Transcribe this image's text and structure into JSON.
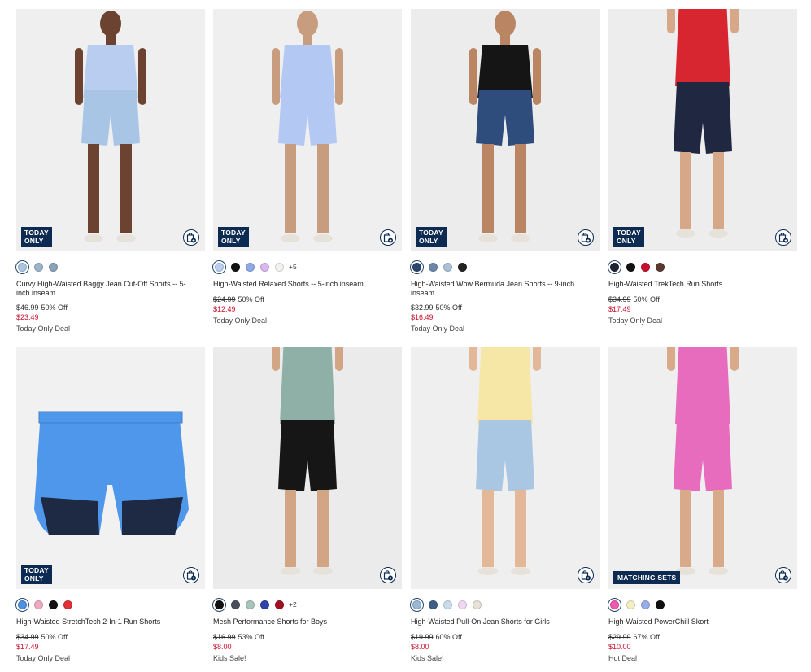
{
  "products": [
    {
      "badge": "TODAY\nONLY",
      "name": "Curvy High-Waisted Baggy Jean Cut-Off Shorts -- 5-inch inseam",
      "original_price": "$46.99",
      "discount": "50% Off",
      "sale_price": "$23.49",
      "promo": "Today Only Deal",
      "swatches": [
        "#aac6e2",
        "#9bb4cc",
        "#8aa2b8"
      ],
      "more_colors": "",
      "image": {
        "bg": "#efefef",
        "top": "#b9cdf0",
        "bottom": "#a8c5e6",
        "skin": "#6b4330"
      }
    },
    {
      "badge": "TODAY\nONLY",
      "name": "High-Waisted Relaxed Shorts -- 5-inch inseam",
      "original_price": "$24.99",
      "discount": "50% Off",
      "sale_price": "$12.49",
      "promo": "Today Only Deal",
      "swatches": [
        "#b9cff0",
        "#111111",
        "#8fa8e8",
        "#d8b8f0",
        "#f2f2ee"
      ],
      "more_colors": "+5",
      "image": {
        "bg": "#efefef",
        "top": "#b3c8f2",
        "bottom": "#b3c8f2",
        "skin": "#c89c7e"
      }
    },
    {
      "badge": "TODAY\nONLY",
      "name": "High-Waisted Wow Bermuda Jean Shorts -- 9-inch inseam",
      "original_price": "$32.99",
      "discount": "50% Off",
      "sale_price": "$16.49",
      "promo": "Today Only Deal",
      "swatches": [
        "#2c4670",
        "#6b86a8",
        "#a9c0d6",
        "#222222"
      ],
      "more_colors": "",
      "image": {
        "bg": "#ececec",
        "top": "#151515",
        "bottom": "#2f4d7c",
        "skin": "#b98563"
      }
    },
    {
      "badge": "TODAY\nONLY",
      "name": "High-Waisted TrekTech Run Shorts",
      "original_price": "$34.99",
      "discount": "50% Off",
      "sale_price": "$17.49",
      "promo": "Today Only Deal",
      "swatches": [
        "#1e2436",
        "#111111",
        "#c8102e",
        "#5a3a30"
      ],
      "more_colors": "",
      "image": {
        "bg": "#ededed",
        "top": "#d7262f",
        "bottom": "#1f2840",
        "skin": "#d6a888"
      }
    },
    {
      "badge": "TODAY\nONLY",
      "name": "High-Waisted StretchTech 2-In-1 Run Shorts",
      "original_price": "$34.99",
      "discount": "50% Off",
      "sale_price": "$17.49",
      "promo": "Today Only Deal",
      "swatches": [
        "#4d8fe0",
        "#f0a9c4",
        "#111111",
        "#e03038"
      ],
      "more_colors": "",
      "image": {
        "bg": "#f1f1f1",
        "top": "#4f97ea",
        "bottom": "#1e2a44",
        "skin": ""
      }
    },
    {
      "badge": "",
      "name": "Mesh Performance Shorts for Boys",
      "original_price": "$16.99",
      "discount": "53% Off",
      "sale_price": "$8.00",
      "promo": "Kids Sale!",
      "swatches": [
        "#111111",
        "#4a4e5a",
        "#a9c4bc",
        "#2f44a8",
        "#a01020"
      ],
      "more_colors": "+2",
      "image": {
        "bg": "#ebebeb",
        "top": "#8fb0a6",
        "bottom": "#161616",
        "skin": "#d2a685"
      }
    },
    {
      "badge": "",
      "name": "High-Waisted Pull-On Jean Shorts for Girls",
      "original_price": "$19.99",
      "discount": "60% Off",
      "sale_price": "$8.00",
      "promo": "Kids Sale!",
      "swatches": [
        "#9bb8d4",
        "#3e5e88",
        "#c9dcec",
        "#f0d8f2",
        "#e8e2d8"
      ],
      "more_colors": "",
      "image": {
        "bg": "#efefef",
        "top": "#f7e7a6",
        "bottom": "#a9c6e2",
        "skin": "#e3b899"
      }
    },
    {
      "badge": "MATCHING SETS",
      "name": "High-Waisted PowerChill Skort",
      "original_price": "$29.99",
      "discount": "67% Off",
      "sale_price": "$10.00",
      "promo": "Hot Deal",
      "swatches": [
        "#ee5ab0",
        "#f5eec2",
        "#98aee8",
        "#111111"
      ],
      "more_colors": "",
      "image": {
        "bg": "#efefef",
        "top": "#e86cbe",
        "bottom": "#e86cbe",
        "skin": "#d8aa8a"
      }
    }
  ]
}
